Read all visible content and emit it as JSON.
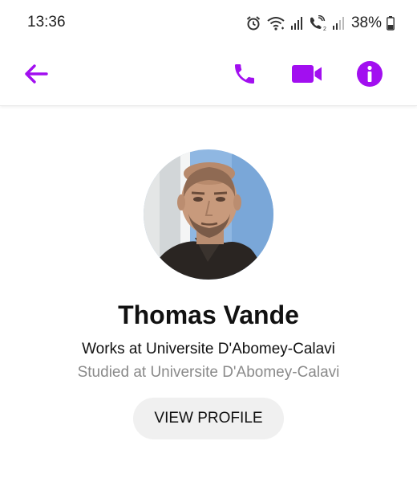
{
  "status_bar": {
    "time": "13:36",
    "battery_percent": "38%",
    "icons": [
      "alarm-icon",
      "wifi-icon",
      "signal-icon",
      "wifi-calling-icon",
      "signal-icon",
      "battery-icon"
    ]
  },
  "app_bar": {
    "icons": [
      "back-arrow-icon",
      "phone-icon",
      "video-camera-icon",
      "info-icon"
    ],
    "accent_color": "#a20ff0"
  },
  "profile": {
    "name": "Thomas Vande",
    "work": "Works at Universite D'Abomey-Calavi",
    "study": "Studied at Universite D'Abomey-Calavi",
    "view_profile_label": "VIEW PROFILE"
  }
}
